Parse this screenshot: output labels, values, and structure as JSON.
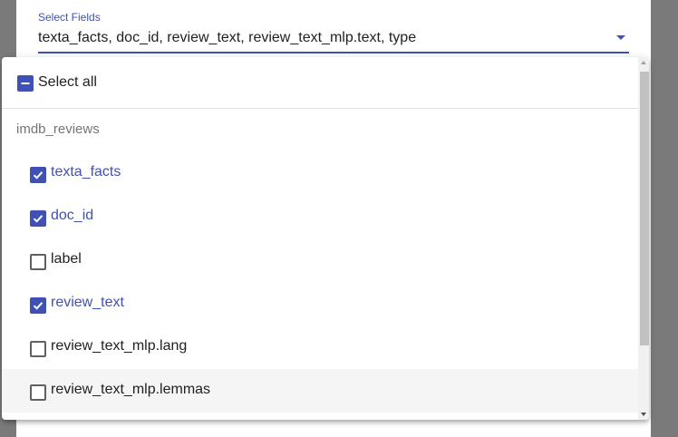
{
  "field": {
    "label": "Select Fields",
    "value": "texta_facts, doc_id, review_text, review_text_mlp.text, type"
  },
  "select_all": {
    "label": "Select all",
    "state": "indeterminate"
  },
  "group": {
    "label": "imdb_reviews"
  },
  "options": [
    {
      "label": "texta_facts",
      "checked": true
    },
    {
      "label": "doc_id",
      "checked": true
    },
    {
      "label": "label",
      "checked": false
    },
    {
      "label": "review_text",
      "checked": true
    },
    {
      "label": "review_text_mlp.lang",
      "checked": false
    },
    {
      "label": "review_text_mlp.lemmas",
      "checked": false
    }
  ],
  "colors": {
    "accent": "#3f51b5",
    "backdrop": "#7a7a7a",
    "hover_row": "#f5f5f5"
  }
}
